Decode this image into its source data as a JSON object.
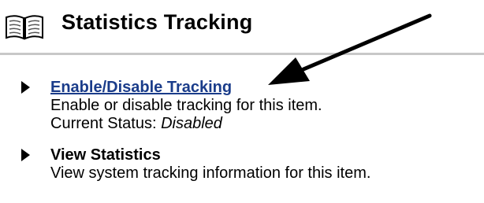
{
  "header": {
    "icon": "book-icon",
    "title": "Statistics Tracking"
  },
  "items": [
    {
      "icon": "triangle-right-icon",
      "title": "Enable/Disable Tracking",
      "description": "Enable or disable tracking for this item.",
      "status_label": "Current Status: ",
      "status_value": "Disabled"
    },
    {
      "icon": "triangle-right-icon",
      "title": "View Statistics",
      "description": "View system tracking information for this item."
    }
  ],
  "colors": {
    "link": "#1a3c8a",
    "divider": "#c8c8c8",
    "annotation_arrow": "#000000"
  },
  "annotation": {
    "icon": "pointer-arrow-icon"
  }
}
